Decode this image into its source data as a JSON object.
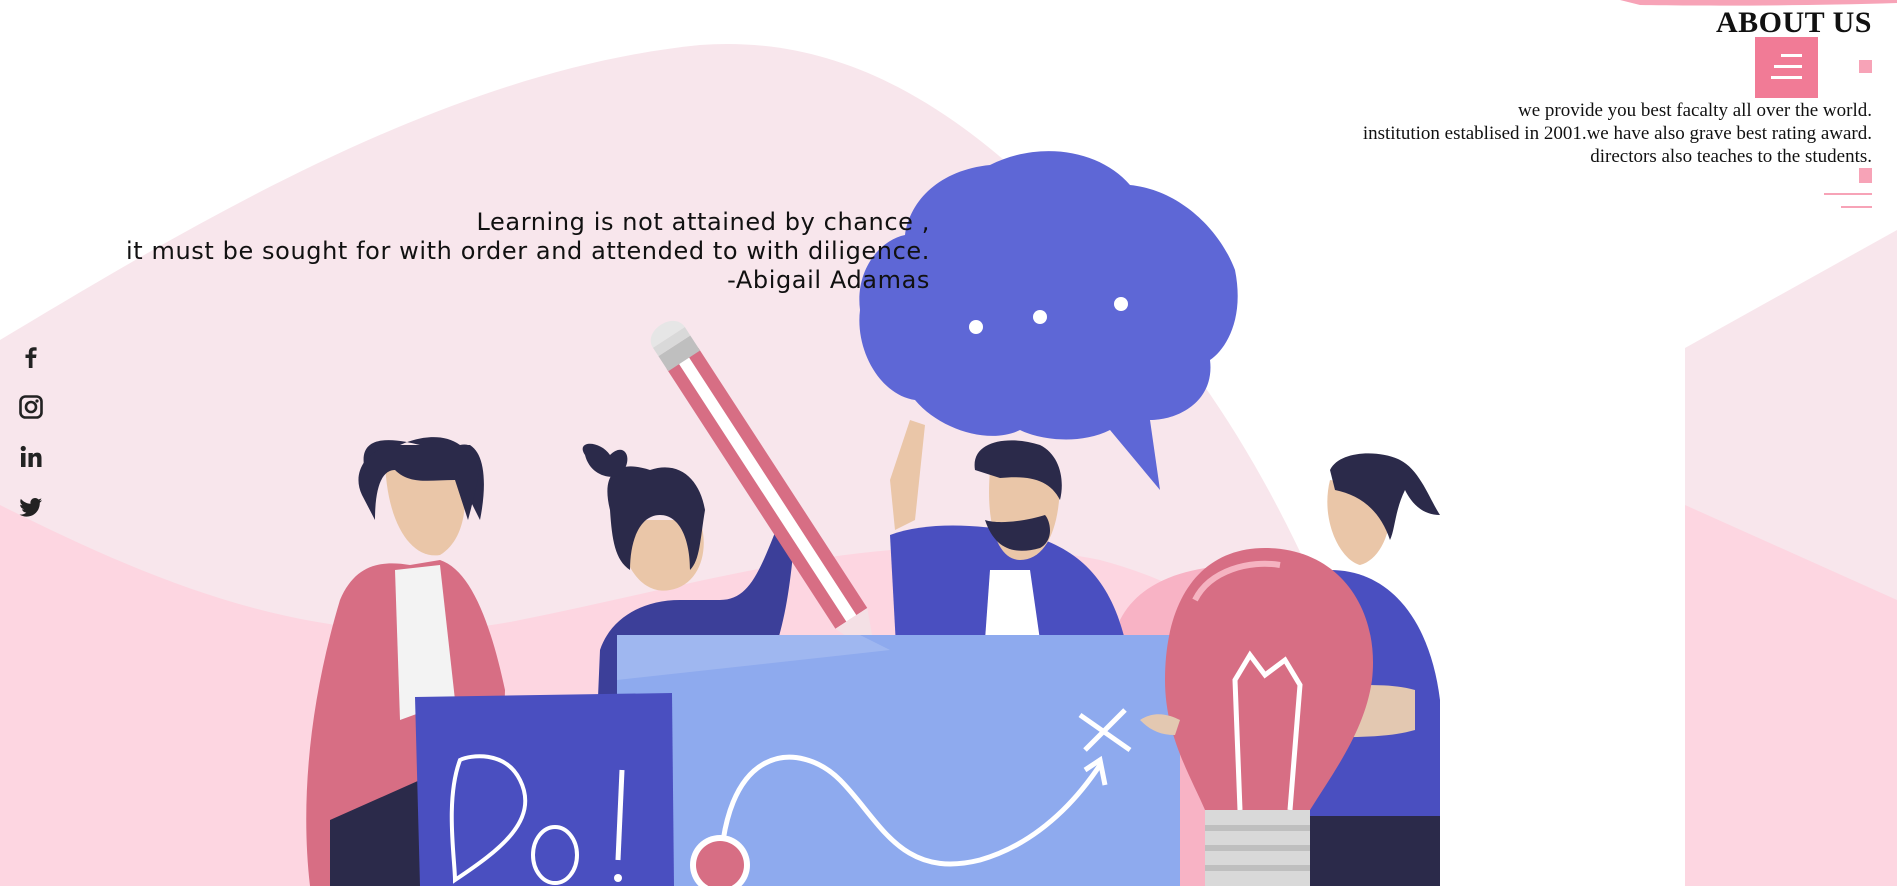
{
  "quote": {
    "line1": "Learning is not attained by chance ,",
    "line2": "it must be sought for with order and attended to with diligence.",
    "author": "-Abigail Adamas"
  },
  "about": {
    "title": "ABOUT US",
    "lines": [
      "we provide you best facalty all over the world.",
      "institution establised in 2001.we have also grave best rating award.",
      "directors also teaches to the students."
    ]
  },
  "social": {
    "icons": [
      "facebook-icon",
      "instagram-icon",
      "linkedin-icon",
      "twitter-icon"
    ]
  },
  "colors": {
    "accent": "#f17b96",
    "pink_light": "#f8e6ec",
    "pink_mid": "#fdd6e1",
    "blue": "#5e67d6",
    "blue_light": "#8eaaee",
    "indigo": "#4a4fc0",
    "red": "#d76e84",
    "dark": "#2b2a4a"
  }
}
